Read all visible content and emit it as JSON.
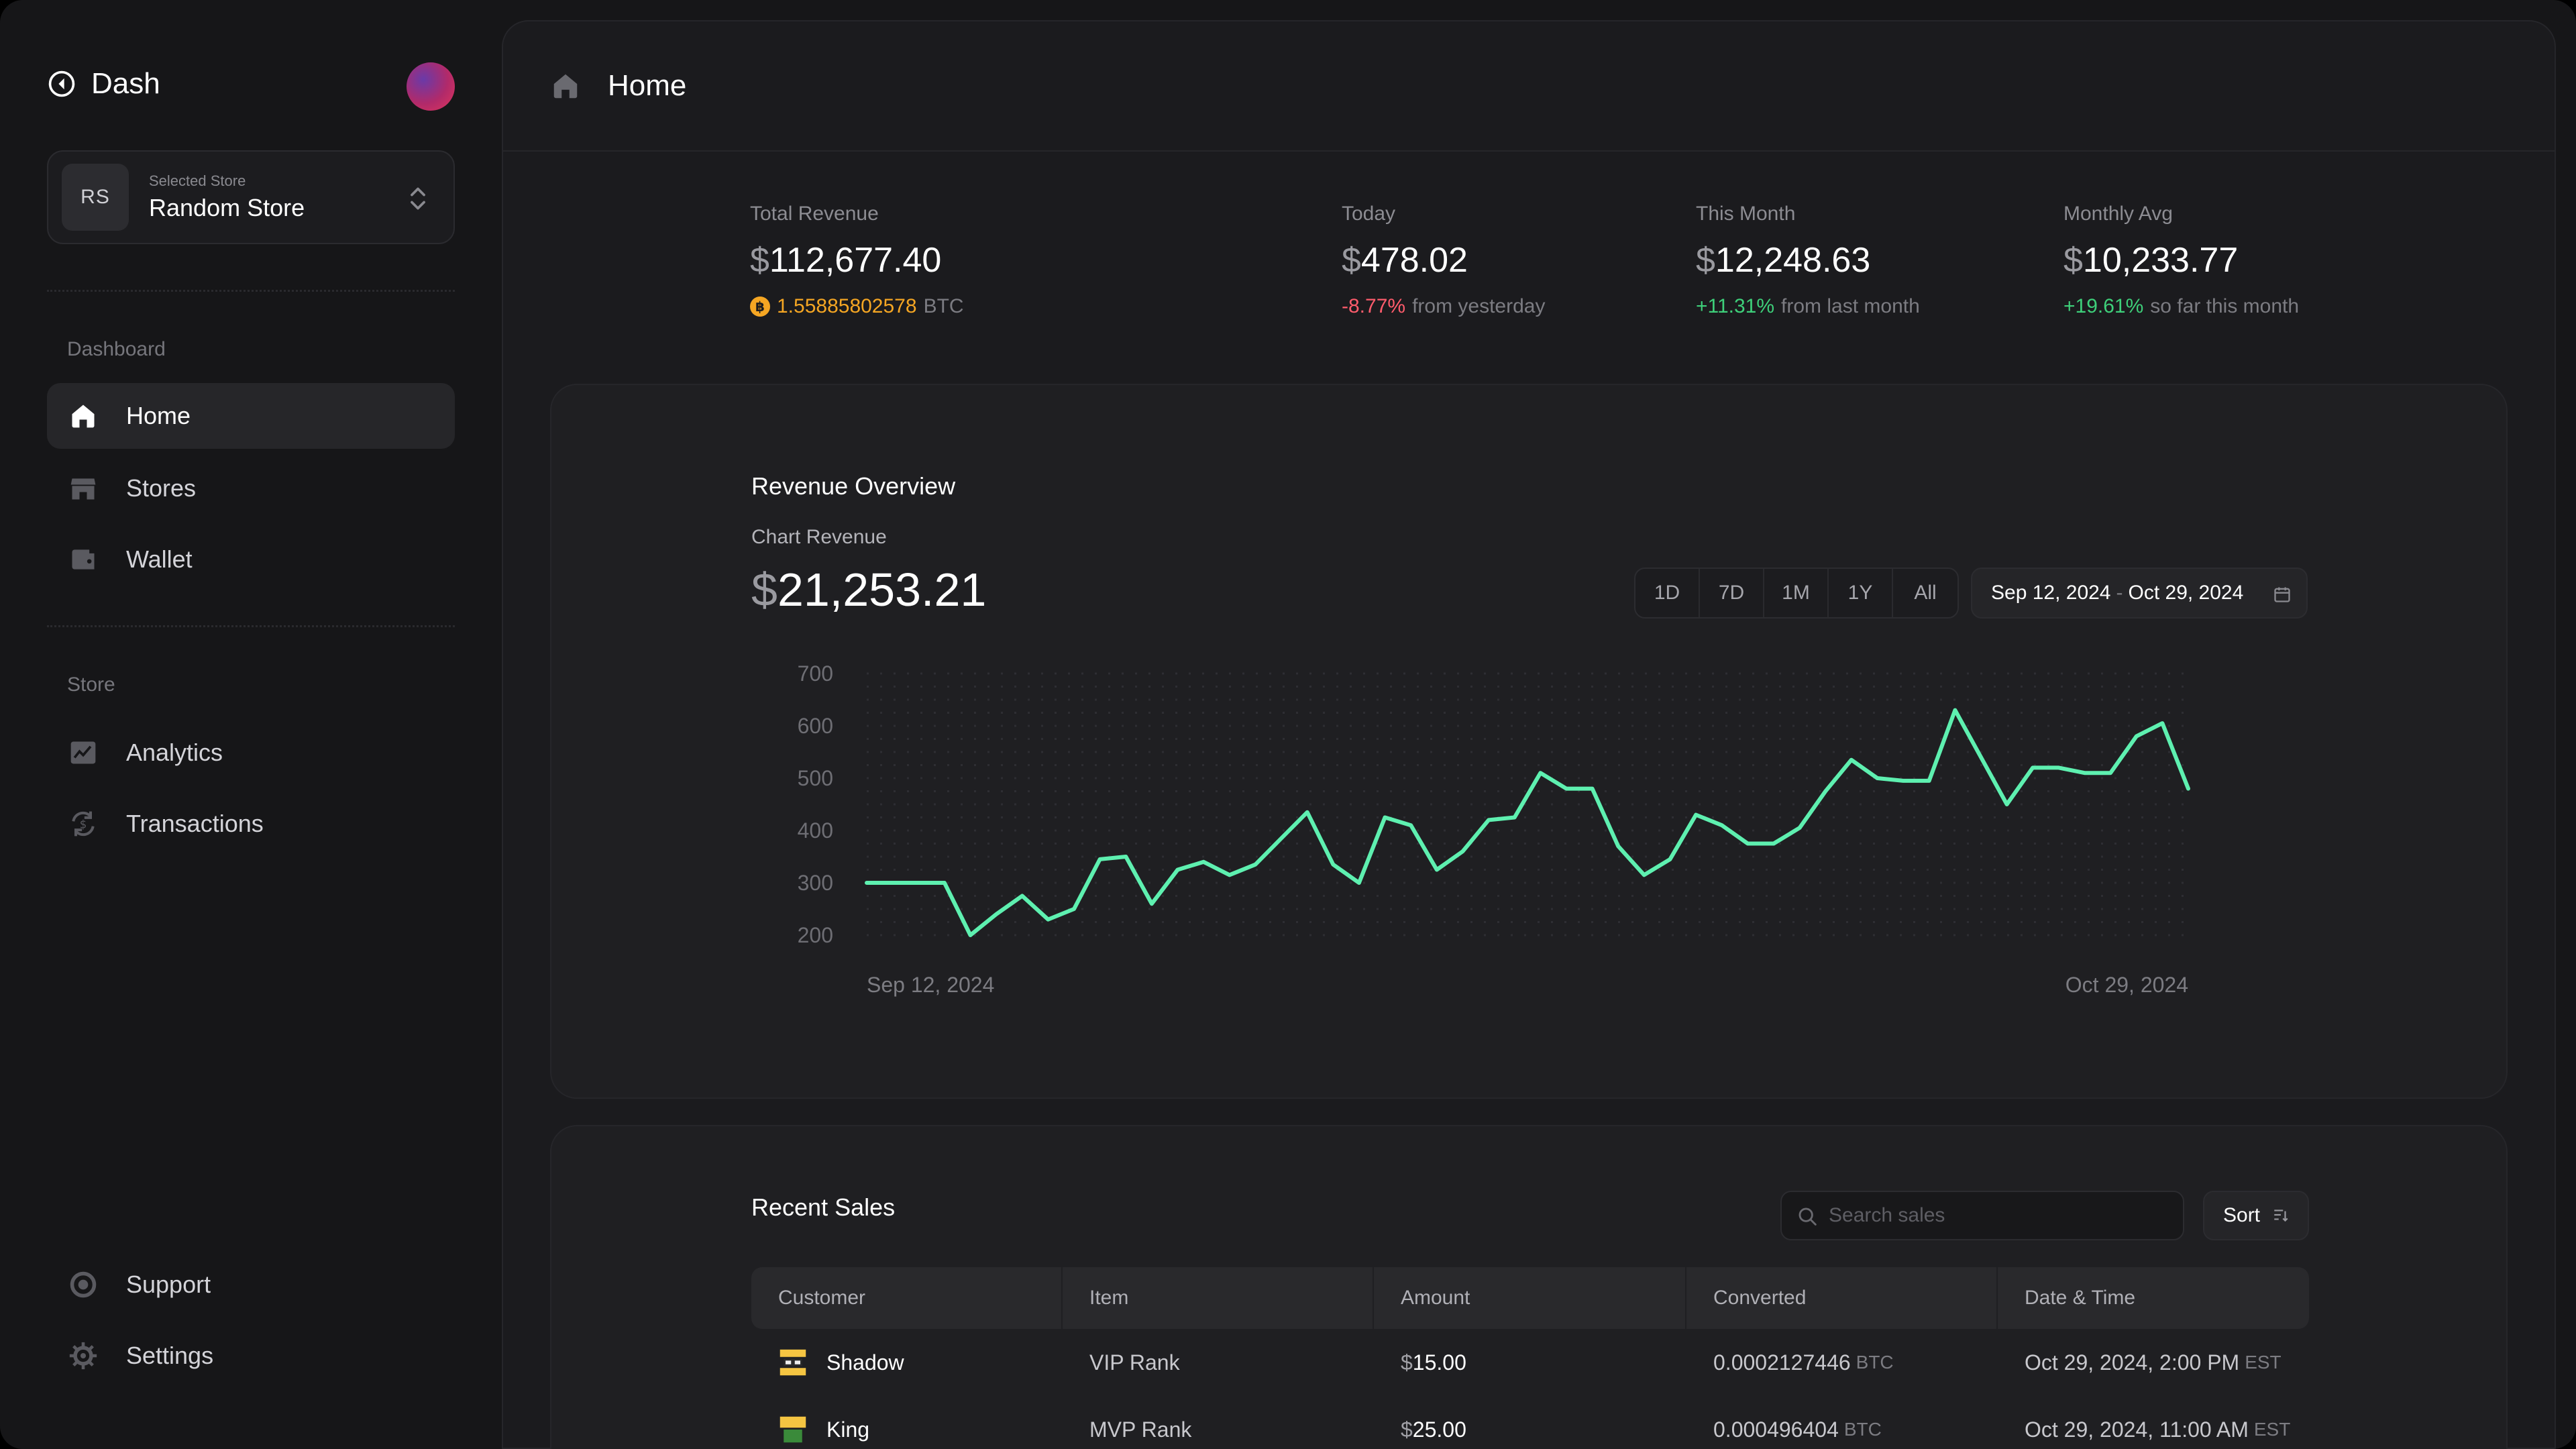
{
  "app": {
    "name": "Dash"
  },
  "store": {
    "caption": "Selected Store",
    "name": "Random Store",
    "initials": "RS"
  },
  "sidebar": {
    "section_dashboard": "Dashboard",
    "section_store": "Store",
    "items": [
      {
        "label": "Home",
        "icon": "home-icon",
        "active": true
      },
      {
        "label": "Stores",
        "icon": "store-icon"
      },
      {
        "label": "Wallet",
        "icon": "wallet-icon"
      },
      {
        "label": "Analytics",
        "icon": "analytics-icon"
      },
      {
        "label": "Transactions",
        "icon": "transactions-icon"
      },
      {
        "label": "Support",
        "icon": "support-icon"
      },
      {
        "label": "Settings",
        "icon": "gear-icon"
      }
    ]
  },
  "header": {
    "title": "Home"
  },
  "stats": {
    "currency": "$",
    "total": {
      "label": "Total Revenue",
      "value": "112,677.40",
      "btc": "1.55885802578",
      "btc_unit": "BTC"
    },
    "today": {
      "label": "Today",
      "value": "478.02",
      "change": "-8.77%",
      "note": "from yesterday"
    },
    "month": {
      "label": "This Month",
      "value": "12,248.63",
      "change": "+11.31%",
      "note": "from last month"
    },
    "avg": {
      "label": "Monthly Avg",
      "value": "10,233.77",
      "change": "+19.61%",
      "note": "so far this month"
    }
  },
  "overview": {
    "title": "Revenue Overview",
    "subtitle": "Chart Revenue",
    "value": "21,253.21",
    "ranges": [
      "1D",
      "7D",
      "1M",
      "1Y",
      "All"
    ],
    "date_start": "Sep 12, 2024",
    "date_sep": "-",
    "date_end": "Oct 29, 2024"
  },
  "chart_data": {
    "type": "line",
    "x_start_label": "Sep 12, 2024",
    "x_end_label": "Oct 29, 2024",
    "ylim": [
      200,
      700
    ],
    "yticks": [
      700,
      600,
      500,
      400,
      300,
      200
    ],
    "color": "#5ef0b0",
    "values": [
      300,
      300,
      300,
      300,
      200,
      240,
      275,
      230,
      250,
      345,
      350,
      260,
      325,
      340,
      315,
      335,
      385,
      435,
      335,
      300,
      425,
      410,
      325,
      360,
      420,
      425,
      510,
      480,
      480,
      370,
      315,
      345,
      430,
      410,
      375,
      375,
      405,
      475,
      535,
      500,
      495,
      495,
      630,
      540,
      450,
      520,
      520,
      510,
      510,
      580,
      605,
      480
    ]
  },
  "sales": {
    "title": "Recent Sales",
    "search_placeholder": "Search sales",
    "sort_label": "Sort",
    "columns": [
      "Customer",
      "Item",
      "Amount",
      "Converted",
      "Date & Time"
    ],
    "rows": [
      {
        "customer": "Shadow",
        "item": "VIP Rank",
        "amount": "15.00",
        "converted": "0.0002127446",
        "unit": "BTC",
        "date": "Oct 29, 2024, 2:00 PM",
        "tz": "EST"
      },
      {
        "customer": "King",
        "item": "MVP Rank",
        "amount": "25.00",
        "converted": "0.000496404",
        "unit": "BTC",
        "date": "Oct 29, 2024, 11:00 AM",
        "tz": "EST"
      }
    ]
  }
}
